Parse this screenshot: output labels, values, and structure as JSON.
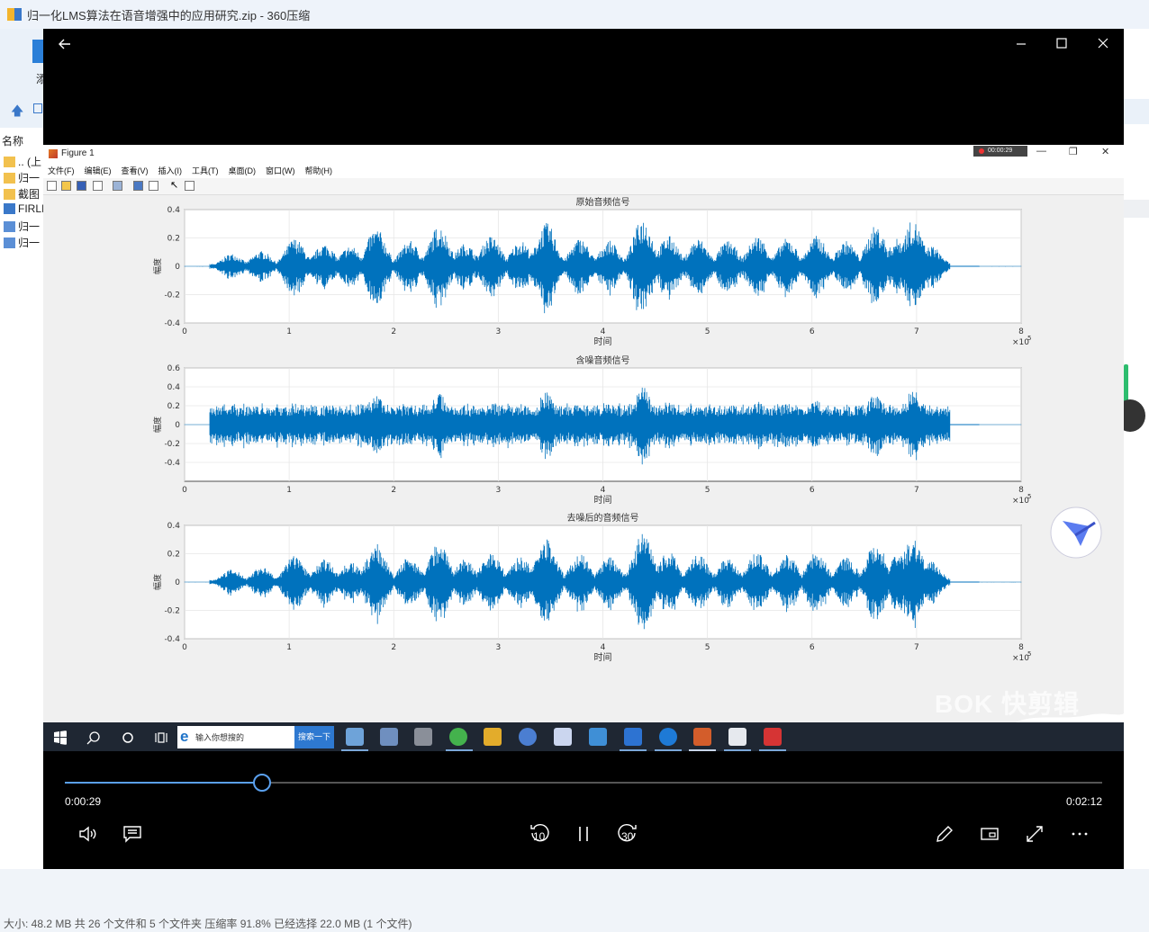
{
  "background_window": {
    "title": "归一化LMS算法在语音增强中的应用研究.zip - 360压缩",
    "toolbar_fragment": "添",
    "column_header": "名称",
    "rows": [
      {
        "icon": "folder-icon",
        "label": ".. (上"
      },
      {
        "icon": "folder-icon",
        "label": "归一"
      },
      {
        "icon": "folder-icon",
        "label": "截图"
      },
      {
        "icon": "file-icon",
        "label": "FIRLI"
      },
      {
        "icon": "doc-icon",
        "label": "归一"
      },
      {
        "icon": "doc-icon",
        "label": "归一"
      }
    ],
    "status": "大小: 48.2 MB 共 26 个文件和 5 个文件夹 压缩率 91.8% 已经选择 22.0 MB (1 个文件)"
  },
  "figure": {
    "title": "Figure 1",
    "recording": "00:00:29",
    "menu": [
      "文件(F)",
      "编辑(E)",
      "查看(V)",
      "插入(I)",
      "工具(T)",
      "桌面(D)",
      "窗口(W)",
      "帮助(H)"
    ],
    "wave_color": "#0072bd"
  },
  "chart_data": [
    {
      "type": "line",
      "title": "原始音频信号",
      "xlabel": "时间",
      "ylabel": "幅度",
      "xlim": [
        0,
        800000
      ],
      "ylim": [
        -0.4,
        0.4
      ],
      "xticks": [
        "0",
        "1",
        "2",
        "3",
        "4",
        "5",
        "6",
        "7",
        "8"
      ],
      "yticks": [
        "0.4",
        "0.2",
        "0",
        "-0.2",
        "-0.4"
      ],
      "x_exponent": "×10",
      "x_exponent_power": "5",
      "grid": true
    },
    {
      "type": "line",
      "title": "含噪音频信号",
      "xlabel": "时间",
      "ylabel": "幅度",
      "xlim": [
        0,
        800000
      ],
      "ylim": [
        -0.6,
        0.6
      ],
      "xticks": [
        "0",
        "1",
        "2",
        "3",
        "4",
        "5",
        "6",
        "7",
        "8"
      ],
      "yticks": [
        "0.6",
        "0.4",
        "0.2",
        "0",
        "-0.2",
        "-0.4"
      ],
      "x_exponent": "×10",
      "x_exponent_power": "5",
      "grid": true
    },
    {
      "type": "line",
      "title": "去噪后的音频信号",
      "xlabel": "时间",
      "ylabel": "幅度",
      "xlim": [
        0,
        800000
      ],
      "ylim": [
        -0.4,
        0.4
      ],
      "xticks": [
        "0",
        "1",
        "2",
        "3",
        "4",
        "5",
        "6",
        "7",
        "8"
      ],
      "yticks": [
        "0.4",
        "0.2",
        "0",
        "-0.2",
        "-0.4"
      ],
      "x_exponent": "×10",
      "x_exponent_power": "5",
      "grid": true
    }
  ],
  "taskbar": {
    "search_placeholder": "输入你想搜的",
    "search_button": "搜索一下"
  },
  "watermark": "BOK 快剪辑",
  "player": {
    "current_time": "0:00:29",
    "total_time": "0:02:12",
    "progress": 0.19,
    "skip_back": "10",
    "skip_forward": "30"
  }
}
